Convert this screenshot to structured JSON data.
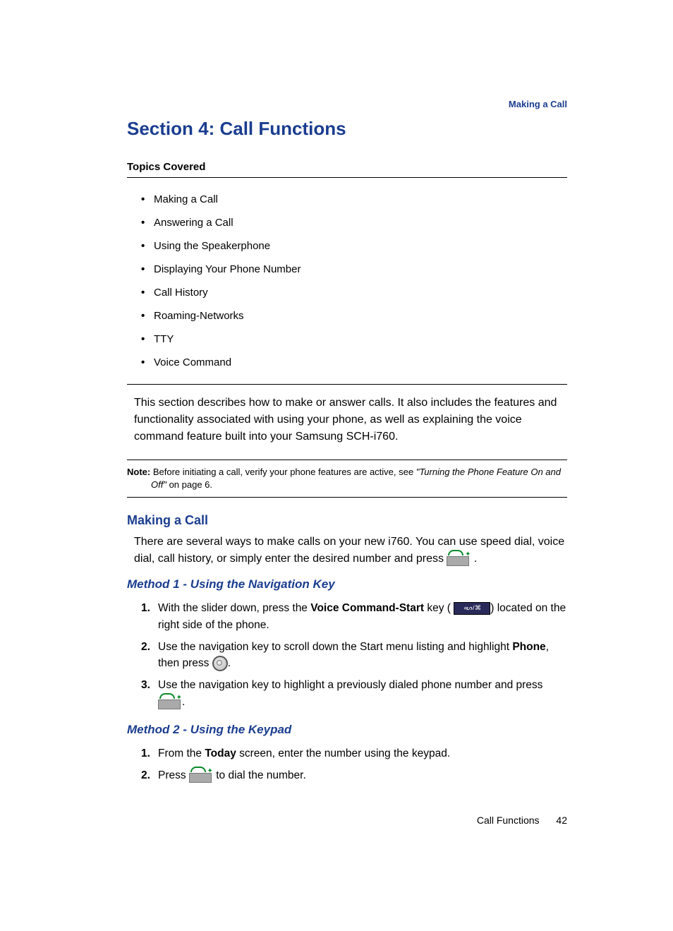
{
  "header": {
    "running_head": "Making a Call"
  },
  "title": "Section 4: Call Functions",
  "topics_heading": "Topics Covered",
  "topics": [
    "Making a Call",
    "Answering a Call",
    "Using the Speakerphone",
    "Displaying Your Phone Number",
    "Call History",
    "Roaming-Networks",
    "TTY",
    "Voice Command"
  ],
  "intro": "This section describes how to make or answer calls. It also includes the features and functionality associated with using your phone, as well as explaining the voice command feature built into your Samsung SCH-i760.",
  "note": {
    "label": "Note:",
    "text": " Before initiating a call, verify your phone features are active, see ",
    "ref": "\"Turning the Phone Feature On and Off\"",
    "tail": "  on page 6."
  },
  "making_a_call": {
    "heading": "Making a Call",
    "text_a": "There are several ways to make calls on your new i760. You can use speed dial, voice dial, call history, or simply enter the desired number and press ",
    "text_b": "."
  },
  "method1": {
    "heading": "Method 1 - Using the Navigation Key",
    "steps": [
      {
        "n": "1.",
        "pre": "With the slider down, press the ",
        "bold": "Voice Command-Start",
        "mid": " key ( ",
        "post": ") located on the right side of the phone."
      },
      {
        "n": "2.",
        "pre": "Use the navigation key to scroll down the Start menu listing and highlight ",
        "bold": "Phone",
        "mid": ", then press ",
        "post": "."
      },
      {
        "n": "3.",
        "pre": "Use the navigation key to highlight a previously dialed phone number and press ",
        "post": "."
      }
    ]
  },
  "method2": {
    "heading": "Method 2 - Using the Keypad",
    "steps": [
      {
        "n": "1.",
        "pre": "From the ",
        "bold": "Today",
        "post": " screen, enter the number using the keypad."
      },
      {
        "n": "2.",
        "pre": "Press ",
        "post": " to dial the number."
      }
    ]
  },
  "footer": {
    "label": "Call Functions",
    "page": "42"
  }
}
